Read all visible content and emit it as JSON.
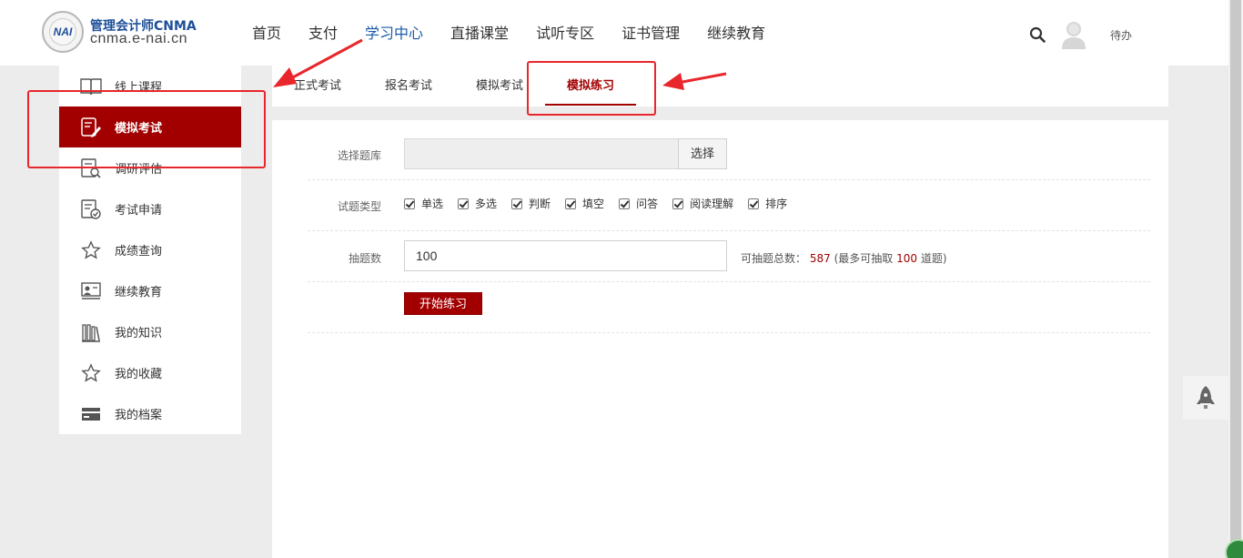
{
  "brand": {
    "logo_text": "NAI",
    "title": "管理会计师CNMA",
    "subtitle": "cnma.e-nai.cn"
  },
  "nav": [
    {
      "label": "首页"
    },
    {
      "label": "支付"
    },
    {
      "label": "学习中心"
    },
    {
      "label": "直播课堂"
    },
    {
      "label": "试听专区"
    },
    {
      "label": "证书管理"
    },
    {
      "label": "继续教育"
    }
  ],
  "header": {
    "todo_label": "待办"
  },
  "sidebar": {
    "items": [
      {
        "label": "线上课程",
        "icon": "book-icon"
      },
      {
        "label": "模拟考试",
        "icon": "exam-edit-icon"
      },
      {
        "label": "调研评估",
        "icon": "survey-icon"
      },
      {
        "label": "考试申请",
        "icon": "application-icon"
      },
      {
        "label": "成绩查询",
        "icon": "star-icon"
      },
      {
        "label": "继续教育",
        "icon": "education-icon"
      },
      {
        "label": "我的知识",
        "icon": "library-icon"
      },
      {
        "label": "我的收藏",
        "icon": "star-icon"
      },
      {
        "label": "我的档案",
        "icon": "card-icon"
      }
    ]
  },
  "tabs": [
    {
      "label": "正式考试"
    },
    {
      "label": "报名考试"
    },
    {
      "label": "模拟考试"
    },
    {
      "label": "模拟练习"
    }
  ],
  "form": {
    "bank_label": "选择题库",
    "bank_button": "选择",
    "bank_value": "",
    "type_label": "试题类型",
    "types": [
      {
        "label": "单选",
        "checked": true
      },
      {
        "label": "多选",
        "checked": true
      },
      {
        "label": "判断",
        "checked": true
      },
      {
        "label": "填空",
        "checked": true
      },
      {
        "label": "问答",
        "checked": true
      },
      {
        "label": "阅读理解",
        "checked": true
      },
      {
        "label": "排序",
        "checked": true
      }
    ],
    "count_label": "抽题数",
    "count_value": "100",
    "total_prefix": "可抽题总数：",
    "total_value": "587",
    "max_prefix": "(最多可抽取",
    "max_value": "100",
    "max_suffix": "道题)",
    "start_button": "开始练习"
  },
  "colors": {
    "accent": "#a20000",
    "nav_active": "#1a5aa8",
    "annotation": "#e8262b"
  }
}
